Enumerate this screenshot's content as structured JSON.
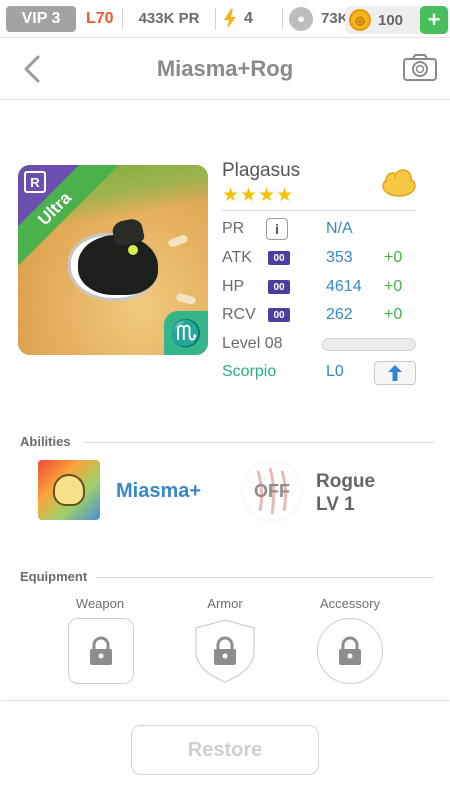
{
  "topbar": {
    "vip": "VIP 3",
    "level": "L70",
    "power": "433K PR",
    "energy": "4",
    "paws": "73K",
    "coins": "100",
    "add": "+"
  },
  "nav": {
    "title": "Miasma+Rog"
  },
  "monster": {
    "rarity": "Ultra",
    "rank_badge": "R",
    "name": "Plagasus",
    "stars": "★★★★",
    "zodiac_symbol": "♏"
  },
  "stats": {
    "pr_label": "PR",
    "pr_info": "i",
    "pr_value": "N/A",
    "atk_label": "ATK",
    "atk_chip": "00",
    "atk_value": "353",
    "atk_bonus": "+0",
    "hp_label": "HP",
    "hp_chip": "00",
    "hp_value": "4614",
    "hp_bonus": "+0",
    "rcv_label": "RCV",
    "rcv_chip": "00",
    "rcv_value": "262",
    "rcv_bonus": "+0",
    "level_label": "Level 08",
    "level_progress": 0.0,
    "zodiac_name": "Scorpio",
    "zodiac_level": "L0"
  },
  "abilities": {
    "header": "Abilities",
    "primary_name": "Miasma+",
    "secondary_status": "OFF",
    "secondary_name": "Rogue",
    "secondary_level": "LV 1"
  },
  "equipment": {
    "header": "Equipment",
    "slots": [
      "Weapon",
      "Armor",
      "Accessory"
    ]
  },
  "footer": {
    "restore": "Restore"
  },
  "colors": {
    "accent_blue": "#3788c8",
    "bonus_green": "#46b04b",
    "zodiac_teal": "#29ad84",
    "level_orange": "#f1592a",
    "rarity_purple": "#6b4fb0"
  },
  "icons": [
    "lightning-icon",
    "paw-icon",
    "coin-icon",
    "back-chevron-icon",
    "camera-icon",
    "cloud-icon",
    "info-icon",
    "upgrade-arrow-icon",
    "lock-icon"
  ]
}
